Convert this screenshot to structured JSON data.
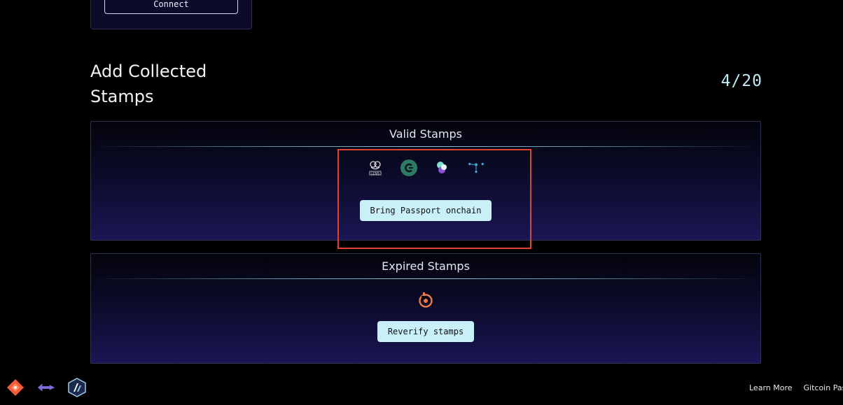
{
  "top_card": {
    "connect_label": "Connect"
  },
  "section": {
    "title": "Add Collected Stamps",
    "counter": "4/20"
  },
  "valid_panel": {
    "title": "Valid Stamps",
    "icons": [
      "lens-icon",
      "civic-icon",
      "zora-icon",
      "network-icon"
    ],
    "action_label": "Bring Passport onchain"
  },
  "expired_panel": {
    "title": "Expired Stamps",
    "icons": [
      "brightid-icon"
    ],
    "action_label": "Reverify stamps"
  },
  "footer": {
    "icons": [
      "gitcoin-icon",
      "optimism-icon",
      "arbitrum-icon"
    ],
    "links": [
      "Learn More",
      "Gitcoin Pass"
    ]
  },
  "colors": {
    "accent_button": "#c9f0f8",
    "counter": "#bfe9f5",
    "highlight": "#e0432f",
    "background": "#000000"
  }
}
